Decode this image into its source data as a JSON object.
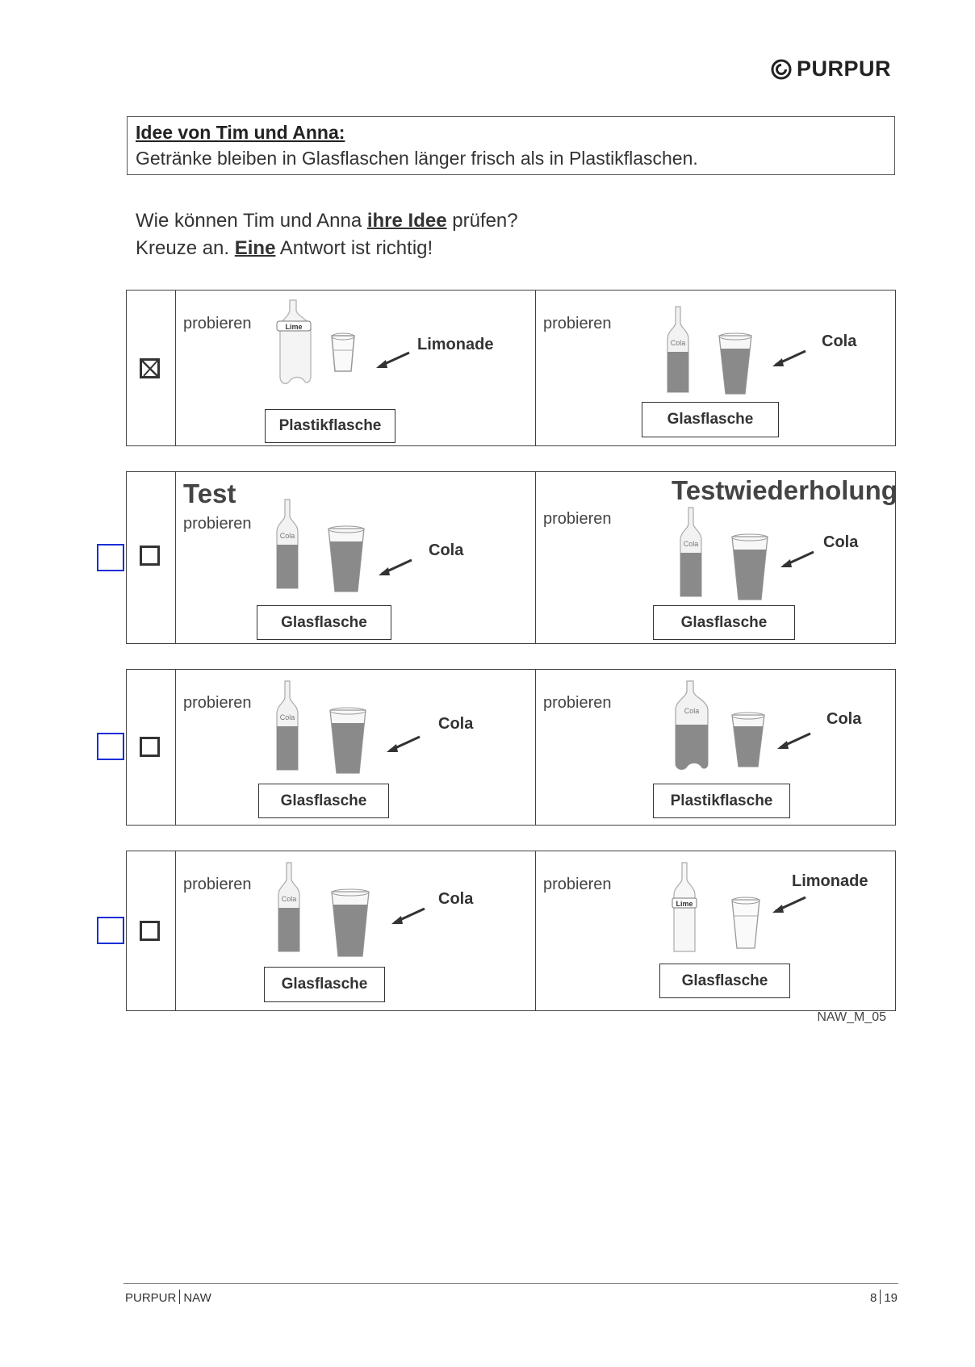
{
  "brand": {
    "name": "PURPUR"
  },
  "idea": {
    "title": "Idee von Tim und Anna:",
    "text": "Getränke bleiben in Glasflaschen länger frisch als in Plastikflaschen."
  },
  "question": {
    "line1_pre": "Wie können Tim und Anna ",
    "line1_emph": "ihre Idee",
    "line1_post": " prüfen?",
    "line2_pre": "Kreuze an. ",
    "line2_emph": "Eine",
    "line2_post": " Antwort ist richtig!"
  },
  "options": [
    {
      "checked": true,
      "left": {
        "verb": "probieren",
        "drink": "Limonade",
        "bottle": "Plastikflasche",
        "bottle_tag": "Lime"
      },
      "right": {
        "verb": "probieren",
        "drink": "Cola",
        "bottle": "Glasflasche",
        "bottle_tag": "Cola"
      }
    },
    {
      "checked": false,
      "left": {
        "heading": "Test",
        "verb": "probieren",
        "drink": "Cola",
        "bottle": "Glasflasche",
        "bottle_tag": "Cola"
      },
      "right": {
        "heading": "Testwiederholung",
        "verb": "probieren",
        "drink": "Cola",
        "bottle": "Glasflasche",
        "bottle_tag": "Cola"
      }
    },
    {
      "checked": false,
      "left": {
        "verb": "probieren",
        "drink": "Cola",
        "bottle": "Glasflasche",
        "bottle_tag": "Cola"
      },
      "right": {
        "verb": "probieren",
        "drink": "Cola",
        "bottle": "Plastikflasche",
        "bottle_tag": "Cola"
      }
    },
    {
      "checked": false,
      "left": {
        "verb": "probieren",
        "drink": "Cola",
        "bottle": "Glasflasche",
        "bottle_tag": "Cola"
      },
      "right": {
        "verb": "probieren",
        "drink": "Limonade",
        "bottle": "Glasflasche",
        "bottle_tag": "Lime"
      }
    }
  ],
  "code": "NAW_M_05",
  "footer": {
    "left_a": "PURPUR",
    "left_b": "NAW",
    "page": "8",
    "total": "19"
  },
  "colors": {
    "selection_box": "#1a2fd6",
    "cola": "#8a8a8a"
  }
}
